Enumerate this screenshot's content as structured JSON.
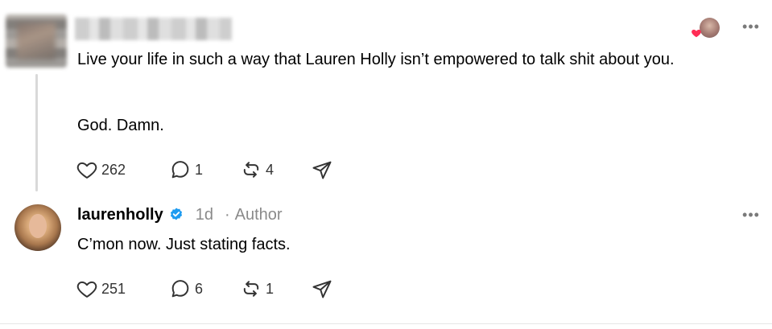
{
  "parent_post": {
    "text": "Live your life in such a way that Lauren Holly isn’t empowered to talk shit about you.",
    "text2": "God. Damn.",
    "likes": "262",
    "replies": "1",
    "reposts": "4"
  },
  "reply_post": {
    "username": "laurenholly",
    "time": "1d",
    "separator": "·",
    "author_label": "Author",
    "text": "C’mon now. Just stating facts.",
    "likes": "251",
    "replies": "6",
    "reposts": "1"
  },
  "icons": {
    "more": "more-horizontal-icon",
    "heart": "heart-icon",
    "reply": "comment-bubble-icon",
    "repost": "repost-icon",
    "share": "share-send-icon",
    "verified": "verified-badge-icon"
  },
  "colors": {
    "verified_blue": "#1d9bf0",
    "heart_badge_red": "#ff2d55",
    "meta_gray": "#8a8a8a",
    "icon_gray": "#333333"
  }
}
